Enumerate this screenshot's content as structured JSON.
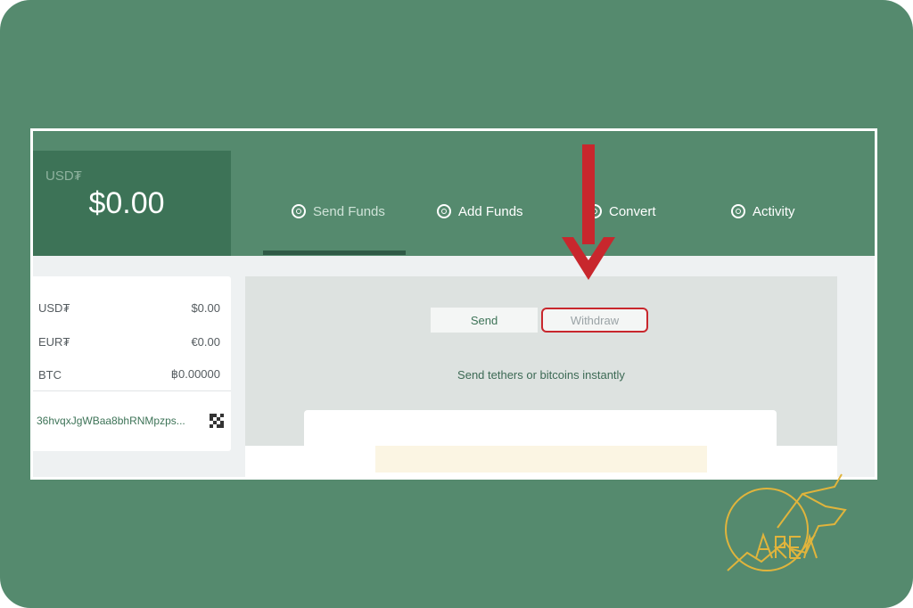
{
  "balance": {
    "currency": "USD₮",
    "amount": "$0.00"
  },
  "tabs": [
    {
      "label": "Send Funds",
      "icon": "send-funds-icon"
    },
    {
      "label": "Add Funds",
      "icon": "add-funds-icon"
    },
    {
      "label": "Convert",
      "icon": "convert-icon"
    },
    {
      "label": "Activity",
      "icon": "activity-icon"
    }
  ],
  "wallets": [
    {
      "name": "USD₮",
      "value": "$0.00"
    },
    {
      "name": "EUR₮",
      "value": "€0.00"
    },
    {
      "name": "BTC",
      "value": "฿0.00000"
    }
  ],
  "address": {
    "text": "36hvqxJgWBaa8bhRNMpzps..."
  },
  "send_panel": {
    "send_label": "Send",
    "withdraw_label": "Withdraw",
    "subtitle": "Send tethers or bitcoins instantly"
  },
  "colors": {
    "background_green": "#558a6e",
    "dark_green": "#3d7357",
    "highlight_red": "#c8272d",
    "logo_gold": "#e0b43c"
  }
}
